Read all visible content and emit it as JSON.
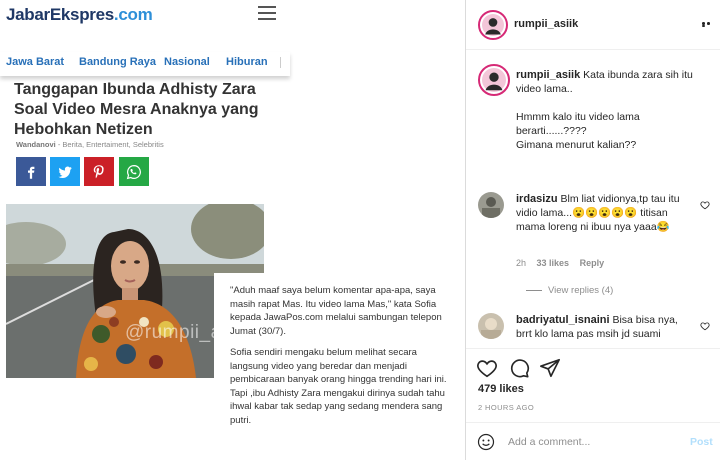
{
  "article": {
    "logo_main": "JabarEkspres",
    "logo_domain": ".com",
    "nav": [
      "Jawa Barat",
      "Bandung Raya",
      "Nasional",
      "Hiburan"
    ],
    "headline": "Tanggapan Ibunda Adhisty Zara Soal Video Mesra Anaknya yang Hebohkan Netizen",
    "author": "Wandanovi",
    "categories": " -  Berita, Entertaiment, Selebritis",
    "watermark": "@rumpii_asiik",
    "paragraphs": [
      "\"Aduh maaf saya belum komentar apa-apa, saya masih rapat Mas. Itu video lama Mas,\" kata Sofia kepada JawaPos.com melalui sambungan telepon Jumat (30/7).",
      "Sofia sendiri mengaku belum melihat secara langsung video yang beredar dan menjadi pembicaraan banyak orang hingga trending hari ini. Tapi ,ibu Adhisty Zara mengakui dirinya sudah tahu ihwal kabar tak sedap yang sedang mendera sang putri."
    ],
    "colors": {
      "facebook": "#3b5998",
      "twitter": "#1da1f2",
      "pinterest": "#cb2027",
      "whatsapp": "#25a845"
    }
  },
  "instagram": {
    "header_username": "rumpii_asiik",
    "caption": {
      "username": "rumpii_asiik",
      "lines": [
        "Kata ibunda zara sih itu video lama..",
        "Hmmm kalo itu video lama berarti......????",
        "Gimana menurut kalian??"
      ]
    },
    "comments": [
      {
        "username": "irdasizu",
        "text": "Blm liat vidionya,tp tau itu vidio lama...😮😮😮😮😮 titisan mama loreng ni ibuu nya yaaa😂",
        "time": "2h",
        "likes": "33 likes",
        "reply": "Reply",
        "view_replies": "View replies (4)"
      },
      {
        "username": "badriyatul_isnaini",
        "text": "Bisa bisa nya, brrt klo lama pas msih jd suami"
      }
    ],
    "likes": "479 likes",
    "timestamp": "2 HOURS AGO",
    "add_comment_placeholder": "Add a comment...",
    "post_label": "Post",
    "accent": "#d62976"
  }
}
